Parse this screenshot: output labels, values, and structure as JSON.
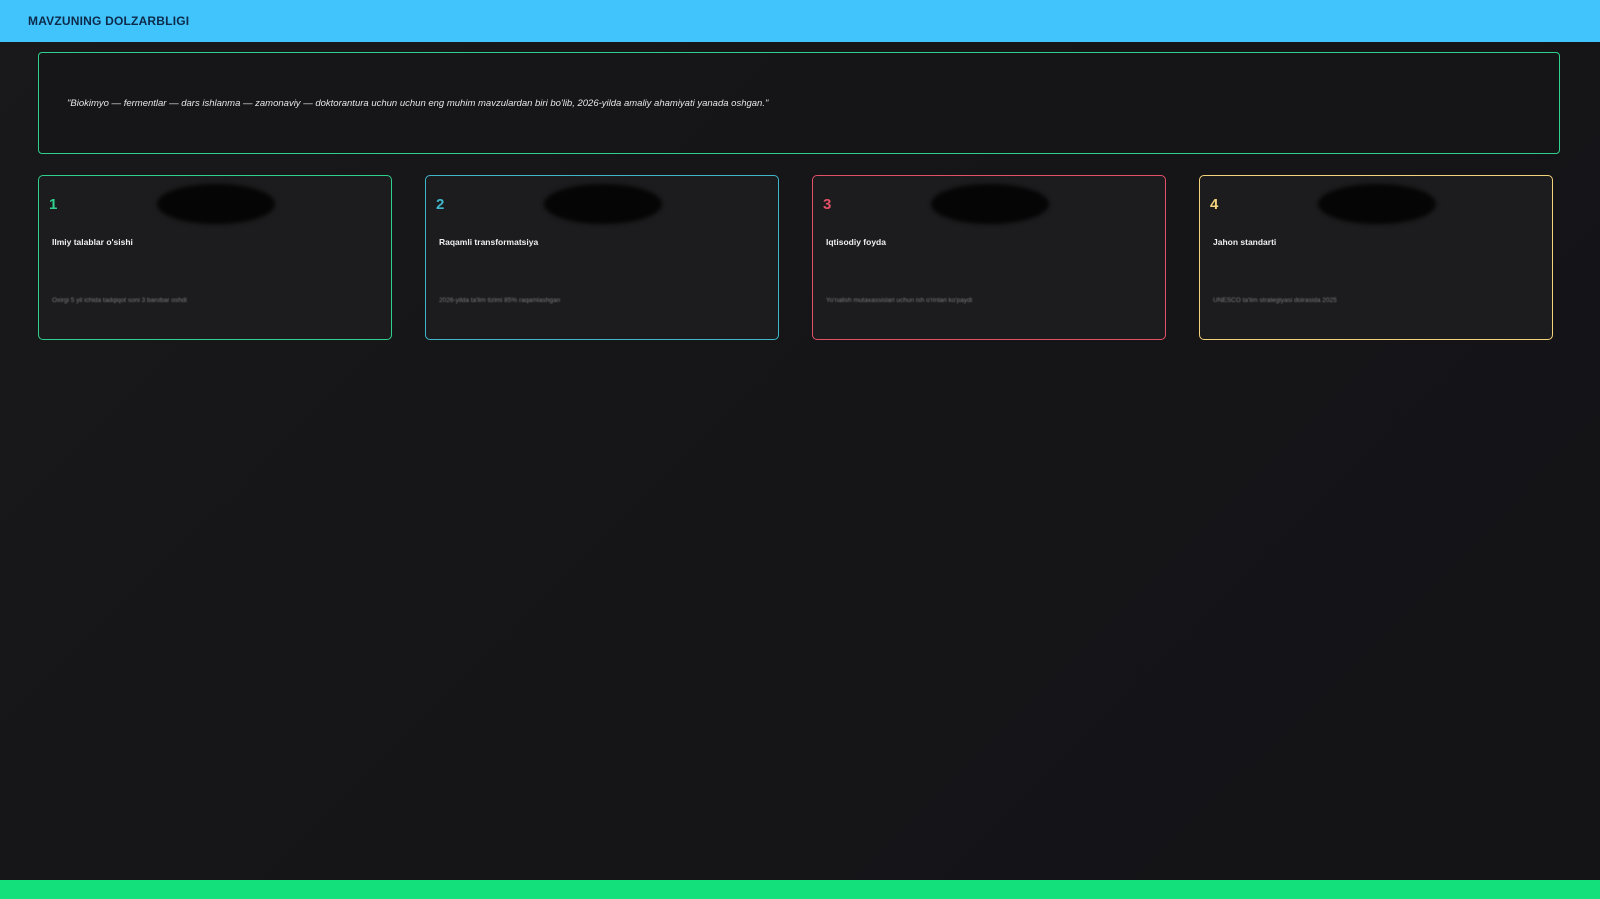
{
  "header": {
    "title": "MAVZUNING DOLZARBLIGI"
  },
  "quote": {
    "text": "\"Biokimyo — fermentlar — dars ishlanma — zamonaviy — doktorantura uchun uchun eng muhim mavzulardan biri bo'lib, 2026-yilda amaliy ahamiyati yanada oshgan.\""
  },
  "cards": [
    {
      "number": "1",
      "title": "Ilmiy talablar o'sishi",
      "description": "Oxirgi 5 yil ichida tadqiqot soni 3 barobar oshdi",
      "accent_color": "#2fcf8e"
    },
    {
      "number": "2",
      "title": "Raqamli transformatsiya",
      "description": "2026-yilda ta'lim tizimi 85% raqamlashgan",
      "accent_color": "#3fb6c9"
    },
    {
      "number": "3",
      "title": "Iqtisodiy foyda",
      "description": "Yo'nalish mutaxassislari uchun ish o'rinlari ko'paydi",
      "accent_color": "#e35068"
    },
    {
      "number": "4",
      "title": "Jahon standarti",
      "description": "UNESCO ta'lim strategiyasi doirasida 2025",
      "accent_color": "#f2d27a"
    }
  ],
  "colors": {
    "header_bg": "#40c4fb",
    "footer_bar": "#13e07a",
    "quote_border": "#2fcf8e"
  }
}
